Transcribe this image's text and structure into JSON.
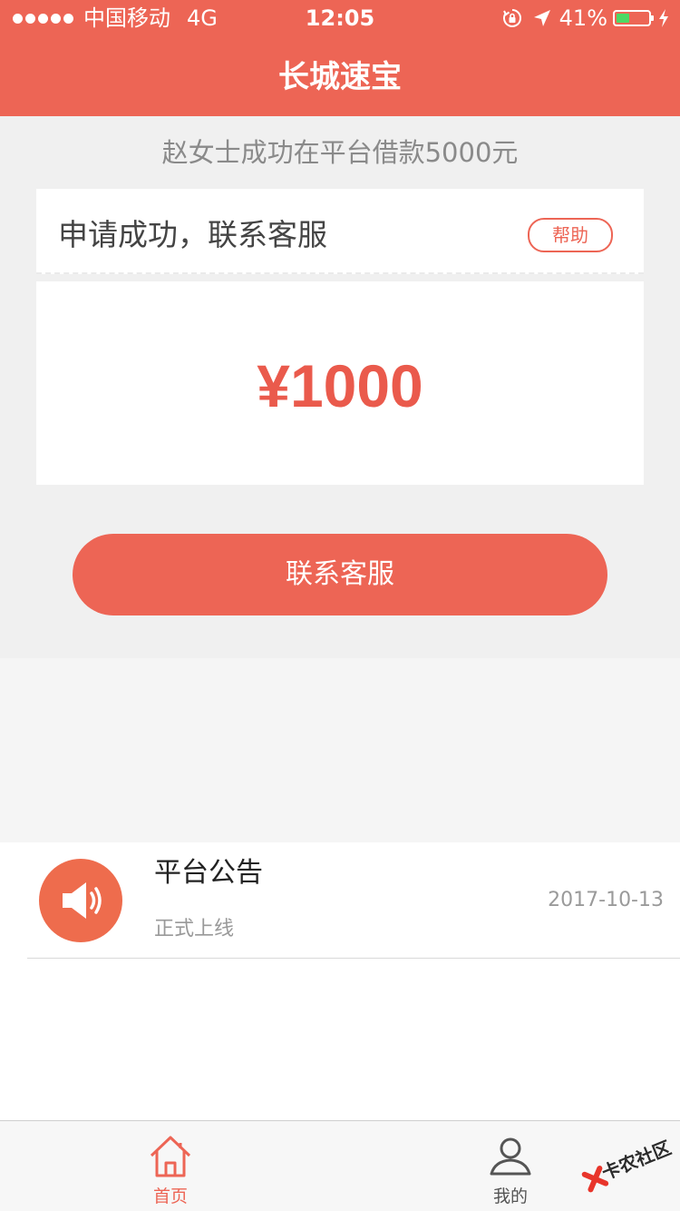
{
  "status_bar": {
    "carrier": "中国移动",
    "network": "4G",
    "time": "12:05",
    "battery_percent": "41%",
    "battery_level": 0.41,
    "battery_color": "#4cd964"
  },
  "header": {
    "title": "长城速宝",
    "background_color": "#ed6555"
  },
  "ticker": {
    "text": "赵女士成功在平台借款5000元"
  },
  "card": {
    "title": "申请成功，联系客服",
    "help_label": "帮助",
    "amount": "¥1000",
    "amount_color": "#ea5a4c"
  },
  "contact_button": {
    "label": "联系客服"
  },
  "notice": {
    "icon": "speaker-icon",
    "title": "平台公告",
    "subtitle": "正式上线",
    "date": "2017-10-13"
  },
  "tab_bar": {
    "tabs": [
      {
        "label": "首页",
        "icon": "home-icon",
        "active": true
      },
      {
        "label": "我的",
        "icon": "user-icon",
        "active": false
      }
    ],
    "active_color": "#ed6555"
  },
  "watermark": {
    "text": "卡农社区"
  }
}
